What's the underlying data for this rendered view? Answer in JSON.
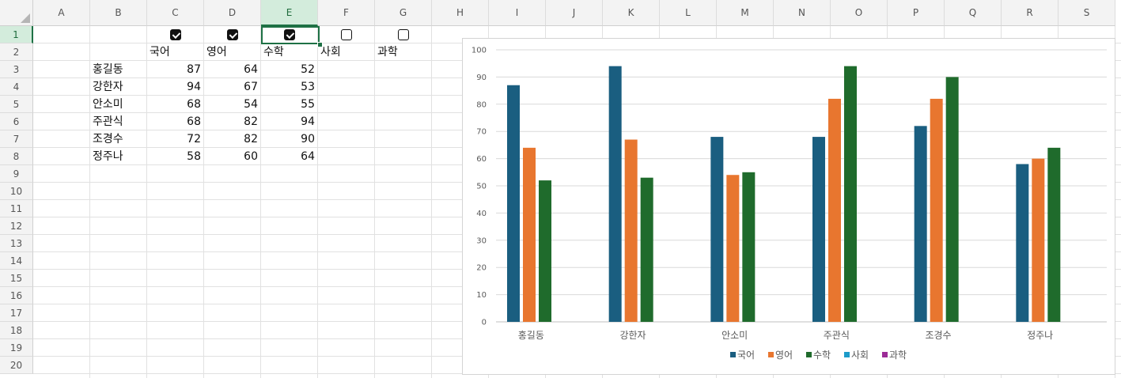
{
  "columns": [
    "A",
    "B",
    "C",
    "D",
    "E",
    "F",
    "G",
    "H",
    "I",
    "J",
    "K",
    "L",
    "M",
    "N",
    "O",
    "P",
    "Q",
    "R",
    "S"
  ],
  "rows": [
    "1",
    "2",
    "3",
    "4",
    "5",
    "6",
    "7",
    "8",
    "9",
    "10",
    "11",
    "12",
    "13",
    "14",
    "15",
    "16",
    "17",
    "18",
    "19",
    "20"
  ],
  "selected_cell": "E1",
  "checkboxes": [
    {
      "col": "C",
      "checked": true
    },
    {
      "col": "D",
      "checked": true
    },
    {
      "col": "E",
      "checked": true
    },
    {
      "col": "F",
      "checked": false
    },
    {
      "col": "G",
      "checked": false
    }
  ],
  "subjects": [
    "국어",
    "영어",
    "수학",
    "사회",
    "과학"
  ],
  "students": [
    {
      "name": "홍길동",
      "scores": [
        87,
        64,
        52
      ]
    },
    {
      "name": "강한자",
      "scores": [
        94,
        67,
        53
      ]
    },
    {
      "name": "안소미",
      "scores": [
        68,
        54,
        55
      ]
    },
    {
      "name": "주관식",
      "scores": [
        68,
        82,
        94
      ]
    },
    {
      "name": "조경수",
      "scores": [
        72,
        82,
        90
      ]
    },
    {
      "name": "정주나",
      "scores": [
        58,
        60,
        64
      ]
    }
  ],
  "chart_data": {
    "type": "bar",
    "categories": [
      "홍길동",
      "강한자",
      "안소미",
      "주관식",
      "조경수",
      "정주나"
    ],
    "series": [
      {
        "name": "국어",
        "color": "#1a5e80",
        "values": [
          87,
          94,
          68,
          68,
          72,
          58
        ]
      },
      {
        "name": "영어",
        "color": "#e8762f",
        "values": [
          64,
          67,
          54,
          82,
          82,
          60
        ]
      },
      {
        "name": "수학",
        "color": "#1f6b2c",
        "values": [
          52,
          53,
          55,
          94,
          90,
          64
        ]
      },
      {
        "name": "사회",
        "color": "#1d9bc9",
        "values": []
      },
      {
        "name": "과학",
        "color": "#9c2b97",
        "values": []
      }
    ],
    "yticks": [
      0,
      10,
      20,
      30,
      40,
      50,
      60,
      70,
      80,
      90,
      100
    ],
    "ylim": [
      0,
      100
    ],
    "grid": true,
    "legend": "bottom"
  }
}
